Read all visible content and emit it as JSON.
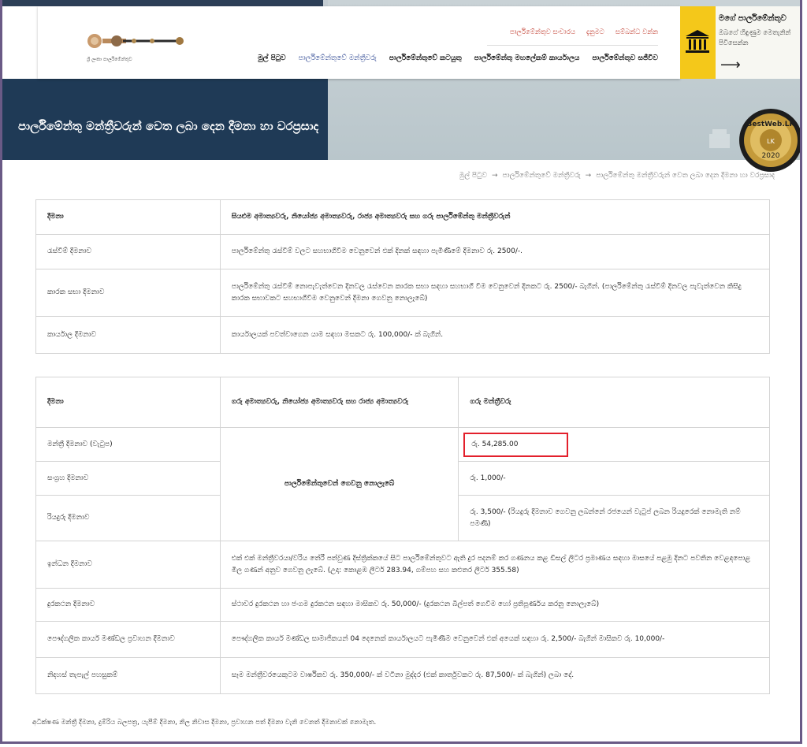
{
  "hero": {
    "title": "පාර්ලිමේන්තු මන්ත්‍රීවරුන් වෙත ලබා දෙන දීමනා හා වරප්‍රසාද"
  },
  "header": {
    "logo_caption": "ශ්‍රී ලංකා පාර්ලිමේන්තුව",
    "top_links": [
      "පාර්ලිමේන්තුව සංචාරය",
      "දැනුමට",
      "සම්බන්ධ වන්න"
    ],
    "nav": [
      {
        "label": "මුල් පිටුව",
        "active": false
      },
      {
        "label": "පාර්ලිමේන්තුවේ මන්ත්‍රීවරු",
        "active": true
      },
      {
        "label": "පාර්ලිමේන්තුවේ කටයුතු",
        "active": false
      },
      {
        "label": "පාර්ලිමේන්තු මහලේකම් කාර්යාලය",
        "active": false
      },
      {
        "label": "පාර්ලිමේන්තුව සජීවීව",
        "active": false
      }
    ]
  },
  "promo": {
    "title": "මගේ පාර්ලිමේන්තුව",
    "text": "ඔබගේ හිඳුණුම මෙතැනින් පිවිසෙන්න",
    "arrow": "⟶",
    "icon": "parliament-building-icon",
    "color": "#f4c81a"
  },
  "badge": {
    "brand": "BestWeb.LK",
    "year": "2020"
  },
  "breadcrumb": {
    "items": [
      "මුල් පිටුව",
      "පාර්ලිමේන්තුවේ මන්ත්‍රීවරු",
      "පාර්ලිමේන්තු මන්ත්‍රීවරුන් වෙත ලබා දෙන දීමනා හා වරප්‍රසාද"
    ],
    "separator": "→"
  },
  "table1": {
    "header": [
      "දීමනා",
      "සියළුම අමාත්‍යවරු, නියෝජ්‍ය අමාත්‍යවරු, රාජ්‍ය අමාත්‍යවරු සහ ගරු පාර්ලිමේන්තු මන්ත්‍රීවරුන්"
    ],
    "rows": [
      [
        "රැස්වීම් දීමනාව",
        "පාර්ලිමේන්තු රැස්වීම් වලට සහභාගීවීම වෙනුවෙන් එක් දිනක් සඳහා පැමිණීමේ දීමනාව රු. 2500/-."
      ],
      [
        "කාරක සභා දීමනාව",
        "පාර්ලිමේන්තු රැස්වීම් නොපැවැත්වෙන දිනවල රැස්වෙන කාරක සභා සඳහා සහභාගී වීම වෙනුවෙන් දිනකට රු. 2500/- බැගින්. (පාර්ලිමේන්තු රැස්වීම් දිනවල පැවැත්වෙන කිසිදු කාරක සභාවකට සහභාගීවීම වෙනුවෙන් දීමනා ගෙවනු නොලැබේ)"
      ],
      [
        "කාර්යාල දීමනාව",
        "කාර්යාලයක් පවත්වාගෙන යාම සඳහා මසකට රු. 100,000/- ක් බැගින්."
      ]
    ]
  },
  "table2": {
    "header": [
      "දීමනා",
      "ගරු අමාත්‍යවරු, නියෝජ්‍ය අමාත්‍යවරු සහ රාජ්‍ය අමාත්‍යවරු",
      "ගරු මන්ත්‍රීවරු"
    ],
    "merged_note": "පාර්ලිමේන්තුවෙන් ගෙවනු නොලැබේ",
    "split_rows": [
      [
        "මන්ත්‍රී දීමනාව (වැටුප)",
        "රු. 54,285.00"
      ],
      [
        "සංග්‍රහ දීමනාව",
        "රු. 1,000/-"
      ],
      [
        "රියදුරු දීමනාව",
        "රු. 3,500/- (රියදුරු දීමනාව ගෙවනු ලබන්නේ රජයෙන් වැටුප් ලබන රියදුරෙක් නොමැති නම් පමණි)"
      ]
    ],
    "full_rows": [
      [
        "ඉන්ධන දීමනාව",
        "එක් එක් මන්ත්‍රීවරයා/වරිය තේරී පත්වුණ දිස්ත්‍රික්කයේ සිට පාර්ලිමේන්තුවට ඇති දුර පදනම් කර ගණනය කළ ඩීසල් ලීටර ප්‍රමාණය සඳහා මාසයේ පළමු දිනට පවතින වෙළඳපොළ මිල ගණන් අනුව ගෙවනු ලැබේ. (උදා: කොළඹ ලීටර් 283.94, ගම්පහ සහ කළුතර ලීටර් 355.58)"
      ],
      [
        "දුරකථන දීමනාව",
        "ස්ථාවර දුරකථන හා ජංගම දුරකථන සඳහා මාසිකව රු. 50,000/- (දුරකථන බිල්පත් ගෙවීම හෝ ප්‍රතිපූර්ණය කරනු නොලැබේ)"
      ],
      [
        "පෞද්ගලික කාර්ය මණ්ඩල ප්‍රවාහන දීමනාව",
        "පෞද්ගලික කාර්ය මණ්ඩල සාමාජිකයන් 04 දෙනෙක් කාර්යාලයට පැමිණීම වෙනුවෙන් එක් අයෙක් සඳහා රු. 2,500/- බැගින් මාසිකව රු. 10,000/-"
      ],
      [
        "නිදහස් තැපැල් පහසුකම්",
        "සෑම මන්ත්‍රීවරයෙකුටම වාර්ෂිකව රු. 350,000/- ක් වටිනා මුද්දර (එක් කාර්තුවකට රු. 87,500/- ක් බැගින්) ලබා දේ."
      ]
    ]
  },
  "footnote": "අධික්ෂණ මන්ත්‍රී දීමනා, දුම්රිය බලපත්‍ර, යැපීම් දීමනා, නිල නිවාස දීමනා, ප්‍රවාහන පත් දීමනා වැනි වෙනත් දීමනාවක් නොමැත."
}
